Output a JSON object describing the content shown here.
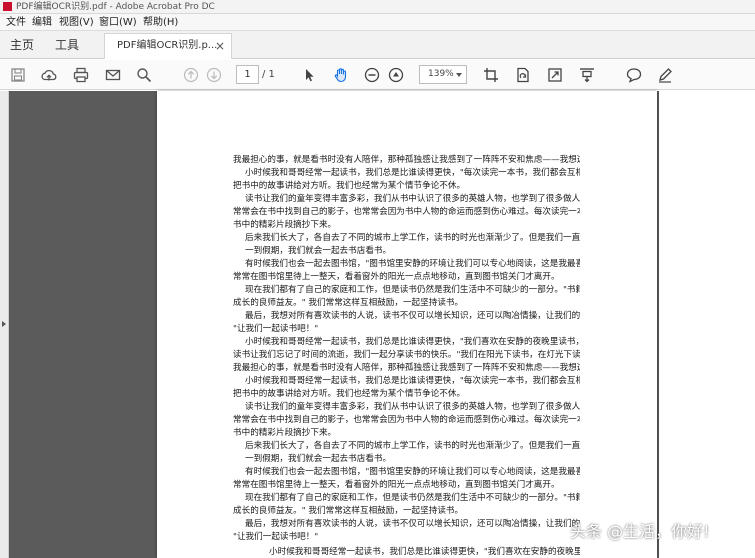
{
  "window": {
    "title": "PDF编辑OCR识别.pdf - Adobe Acrobat Pro DC"
  },
  "menu": [
    "文件",
    "编辑",
    "视图(V)",
    "窗口(W)",
    "帮助(H)"
  ],
  "tabs": {
    "home": "主页",
    "tools": "工具",
    "document": "PDF编辑OCR识别.p...",
    "close": "×"
  },
  "toolbar": {
    "icons": [
      "save-icon",
      "upload-cloud-icon",
      "print-icon",
      "mail-icon",
      "search-icon",
      "page-up-icon",
      "page-down-icon",
      "select-pointer-icon",
      "hand-tool-icon",
      "zoom-out-icon",
      "zoom-in-icon",
      "crop-icon",
      "rotate-page-icon",
      "fit-page-icon",
      "scroll-mode-icon",
      "comment-icon",
      "pen-icon"
    ],
    "page_current": "1",
    "page_total": "/ 1",
    "zoom": "139%"
  },
  "document": {
    "lines": [
      "我最担心的事，就是看书时没有人陪伴，那种孤独感让我感到了一阵阵不安和焦虑——我想这也是。",
      "小时候我和哥哥经常一起读书，我们总是比谁读得更快，\"每次读完一本书，我们都会互相交流读后的感受\" 我们总是",
      "把书中的故事讲给对方听。我们也经常为某个情节争论不休。",
      "读书让我们的童年变得丰富多彩，我们从书中认识了很多的英雄人物，也学到了很多做人的道理和知识。我们",
      "常常会在书中找到自己的影子，也常常会因为书中人物的命运而感到伤心难过。每次读完一本书，我们都会把",
      "书中的精彩片段摘抄下来。",
      "后来我们长大了，各自去了不同的城市上学工作，读书的时光也渐渐少了。但是我们一直保持着读书的习惯。",
      "一到假期，我们就会一起去书店看书。",
      "有时候我们也会一起去图书馆，\"图书馆里安静的环境让我们可以专心地阅读，这是我最喜欢的地方。\" 我们",
      "常常在图书馆里待上一整天，看着窗外的阳光一点点地移动，直到图书馆关门才离开。",
      "现在我们都有了自己的家庭和工作，但是读书仍然是我们生活中不可缺少的一部分。\"书籍是人类进步的阶梯，也是我们",
      "成长的良师益友。\" 我们常常这样互相鼓励，一起坚持读书。",
      "最后，我想对所有喜欢读书的人说，读书不仅可以增长知识，还可以陶冶情操，让我们的生活变得更加美好，",
      "\"让我们一起读书吧！\"",
      "小时候我和哥哥经常一起读书，我们总是比谁读得更快，\"我们喜欢在安静的夜晚里读书，",
      "读书让我们忘记了时间的流逝，我们一起分享读书的快乐。\"我们在阳光下读书，在灯光下读书，\"读书是我们最快乐的事情！\"",
      "我最担心的事，就是看书时没有人陪伴，那种孤独感让我感到了一阵阵不安和焦虑——我想这也是。",
      "小时候我和哥哥经常一起读书，我们总是比谁读得更快，\"每次读完一本书，我们都会互相交流读后的感受\" 我们总是",
      "把书中的故事讲给对方听。我们也经常为某个情节争论不休。",
      "读书让我们的童年变得丰富多彩，我们从书中认识了很多的英雄人物，也学到了很多做人的道理和知识。我们",
      "常常会在书中找到自己的影子，也常常会因为书中人物的命运而感到伤心难过。每次读完一本书，我们都会把",
      "书中的精彩片段摘抄下来。",
      "后来我们长大了，各自去了不同的城市上学工作，读书的时光也渐渐少了。但是我们一直保持着读书的习惯。",
      "一到假期，我们就会一起去书店看书。",
      "有时候我们也会一起去图书馆，\"图书馆里安静的环境让我们可以专心地阅读，这是我最喜欢的地方。\" 我们",
      "常常在图书馆里待上一整天，看着窗外的阳光一点点地移动，直到图书馆关门才离开。",
      "现在我们都有了自己的家庭和工作，但是读书仍然是我们生活中不可缺少的一部分。\"书籍是人类进步的阶梯，也是我们",
      "成长的良师益友。\" 我们常常这样互相鼓励，一起坚持读书。",
      "最后，我想对所有喜欢读书的人说，读书不仅可以增长知识，还可以陶冶情操，让我们的生活变得更加美好，",
      "\"让我们一起读书吧！\"",
      "小时候我和哥哥经常一起读书，我们总是比谁读得更快，\"我们喜欢在安静的夜晚里读书，"
    ]
  },
  "watermark": "头条 @生活，你好!",
  "colors": {
    "workspace": "#5b5b5b",
    "acrobat_red": "#c8102e",
    "active_tool": "#1473e6"
  }
}
